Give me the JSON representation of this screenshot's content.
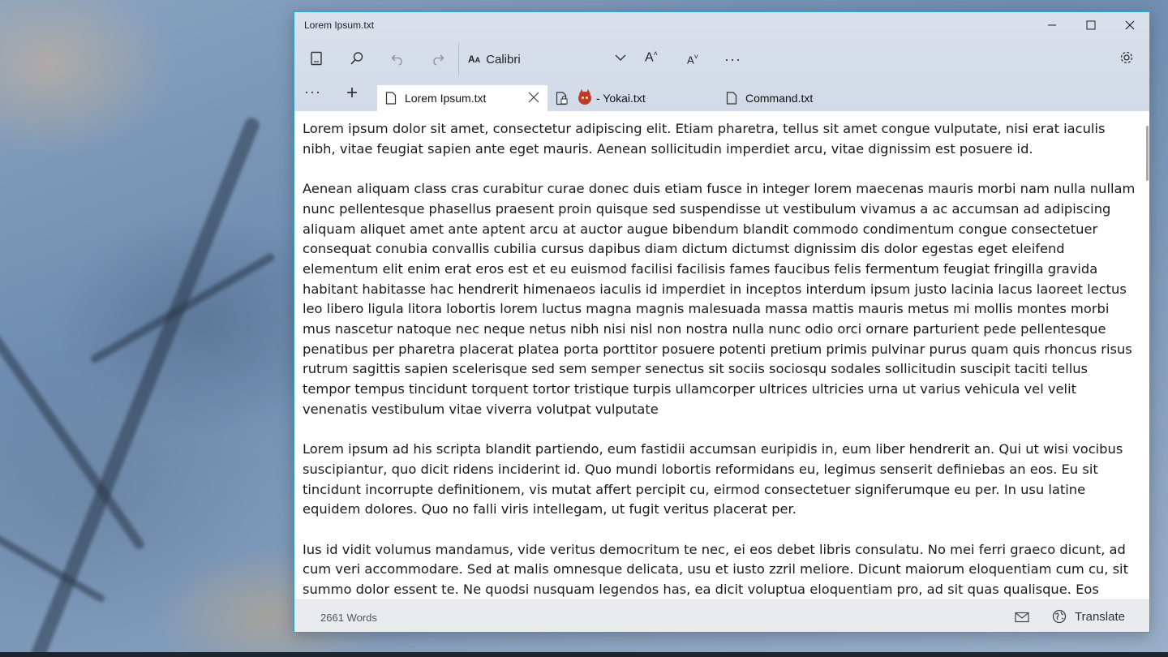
{
  "window": {
    "title": "Lorem Ipsum.txt"
  },
  "toolbar": {
    "font_name": "Calibri",
    "font_aa": "A",
    "font_aa_small": "A",
    "increase_label": "A",
    "decrease_label": "A",
    "more": "···"
  },
  "tabs": {
    "menu": "···",
    "add": "+",
    "items": [
      {
        "label": "Lorem Ipsum.txt"
      },
      {
        "label": "- Yokai.txt"
      },
      {
        "label": "Command.txt"
      }
    ]
  },
  "editor": {
    "paragraphs": [
      "Lorem ipsum dolor sit amet, consectetur adipiscing elit. Etiam pharetra, tellus sit amet congue vulputate, nisi erat iaculis nibh, vitae feugiat sapien ante eget mauris. Aenean sollicitudin imperdiet arcu, vitae dignissim est posuere id.",
      "Aenean aliquam class cras curabitur curae donec duis etiam fusce in integer lorem maecenas mauris morbi nam nulla nullam nunc pellentesque phasellus praesent proin quisque sed suspendisse ut vestibulum vivamus a ac accumsan ad adipiscing aliquam aliquet amet ante aptent arcu at auctor augue bibendum blandit commodo condimentum congue consectetuer consequat conubia convallis cubilia cursus dapibus diam dictum dictumst dignissim dis dolor egestas eget eleifend elementum elit enim erat eros est et eu euismod facilisi facilisis fames faucibus felis fermentum feugiat fringilla gravida habitant habitasse hac hendrerit himenaeos iaculis id imperdiet in inceptos interdum ipsum justo lacinia lacus laoreet lectus leo libero ligula litora lobortis lorem luctus magna magnis malesuada massa mattis mauris metus mi mollis montes morbi mus nascetur natoque nec neque netus nibh nisi nisl non nostra nulla nunc odio orci ornare parturient pede pellentesque penatibus per pharetra placerat platea porta porttitor posuere potenti pretium primis pulvinar purus quam quis rhoncus risus rutrum sagittis sapien scelerisque sed sem semper senectus sit sociis sociosqu sodales sollicitudin suscipit taciti tellus tempor tempus tincidunt torquent tortor tristique turpis ullamcorper ultrices ultricies urna ut varius vehicula vel velit venenatis vestibulum vitae viverra volutpat vulputate",
      "Lorem ipsum ad his scripta blandit partiendo, eum fastidii accumsan euripidis in, eum liber hendrerit an. Qui ut wisi vocibus suscipiantur, quo dicit ridens inciderint id. Quo mundi lobortis reformidans eu, legimus senserit definiebas an eos. Eu sit tincidunt incorrupte definitionem, vis mutat affert percipit cu, eirmod consectetuer signiferumque eu per. In usu latine equidem dolores. Quo no falli viris intellegam, ut fugit veritus placerat per.",
      "Ius id vidit volumus mandamus, vide veritus democritum te nec, ei eos debet libris consulatu. No mei ferri graeco dicunt, ad cum veri accommodare. Sed at malis omnesque delicata, usu et iusto zzril meliore. Dicunt maiorum eloquentiam cum cu, sit summo dolor essent te. Ne quodsi nusquam legendos has, ea dicit voluptua eloquentiam pro, ad sit quas qualisque. Eos"
    ]
  },
  "status": {
    "word_count": "2661 Words",
    "translate_label": "Translate"
  },
  "colors": {
    "window_border": "#2ba4c9",
    "chrome_bg": "#d6dee9",
    "status_bg": "#e9ebee"
  }
}
